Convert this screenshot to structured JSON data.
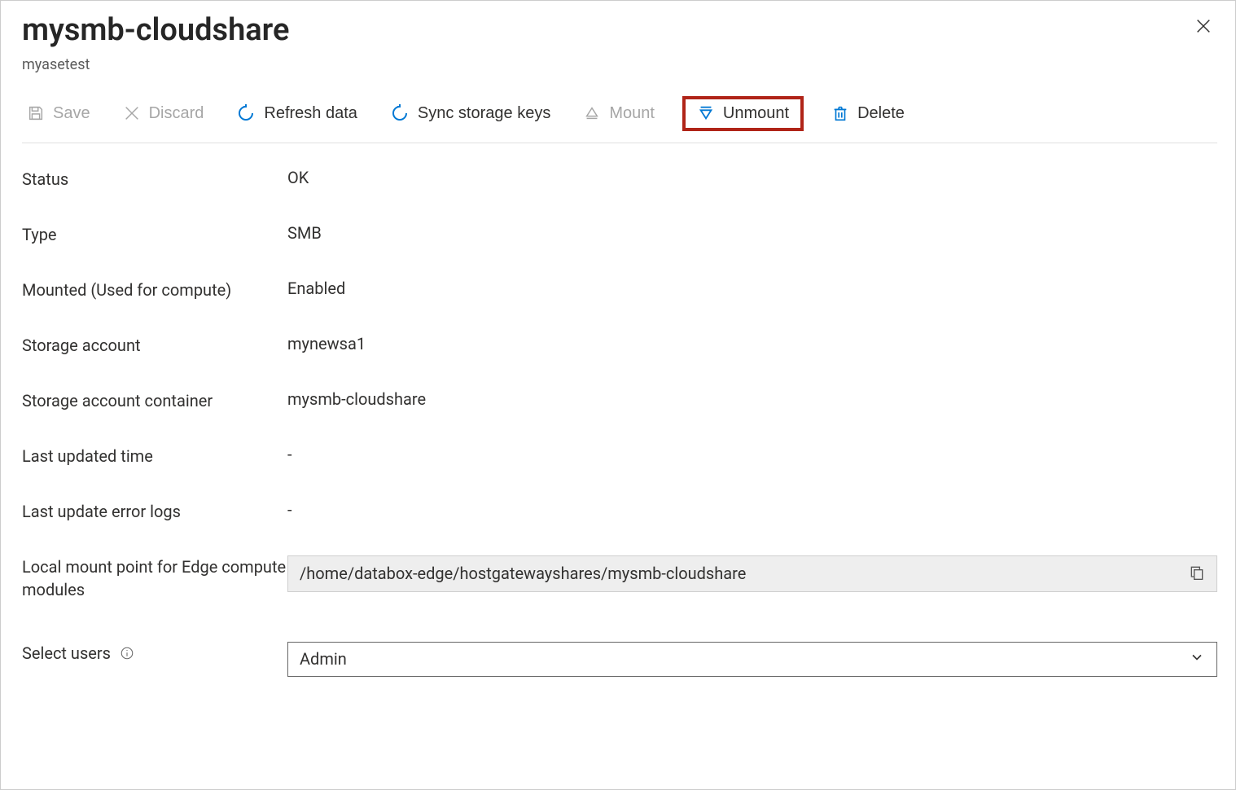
{
  "header": {
    "title": "mysmb-cloudshare",
    "subtitle": "myasetest"
  },
  "toolbar": {
    "save": "Save",
    "discard": "Discard",
    "refresh": "Refresh data",
    "sync": "Sync storage keys",
    "mount": "Mount",
    "unmount": "Unmount",
    "delete": "Delete"
  },
  "props": {
    "status_label": "Status",
    "status_value": "OK",
    "type_label": "Type",
    "type_value": "SMB",
    "mounted_label": "Mounted (Used for compute)",
    "mounted_value": "Enabled",
    "storage_account_label": "Storage account",
    "storage_account_value": "mynewsa1",
    "container_label": "Storage account container",
    "container_value": "mysmb-cloudshare",
    "last_updated_label": "Last updated time",
    "last_updated_value": "-",
    "error_logs_label": "Last update error logs",
    "error_logs_value": "-",
    "mount_point_label": "Local mount point for Edge compute modules",
    "mount_point_value": "/home/databox-edge/hostgatewayshares/mysmb-cloudshare",
    "select_users_label": "Select users",
    "select_users_value": "Admin"
  }
}
